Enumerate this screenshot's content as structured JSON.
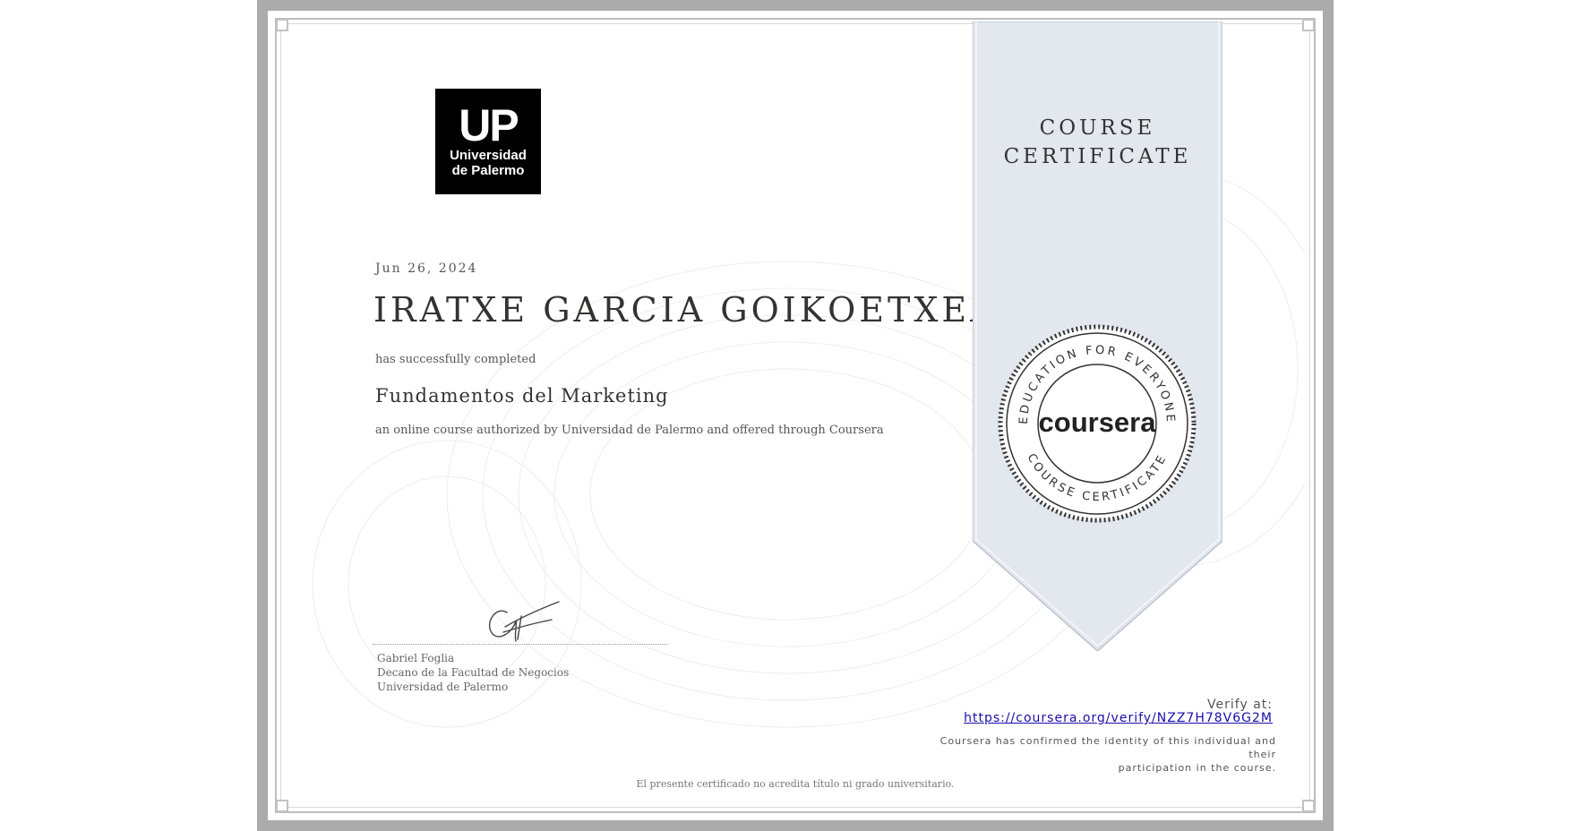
{
  "institution": {
    "logo_big": "UP",
    "logo_line1": "Universidad",
    "logo_line2": "de Palermo"
  },
  "certificate": {
    "date": "Jun 26, 2024",
    "recipient": "IRATXE GARCIA GOIKOETXEA",
    "completed_text": "has successfully completed",
    "course_name": "Fundamentos del Marketing",
    "authorization": "an online course authorized by Universidad de Palermo and offered through Coursera"
  },
  "signatory": {
    "name": "Gabriel Foglia",
    "title": "Decano de la Facultad de Negocios",
    "organization": "Universidad de Palermo"
  },
  "ribbon": {
    "line1": "COURSE",
    "line2": "CERTIFICATE"
  },
  "seal": {
    "brand": "coursera",
    "top_arc": "EDUCATION FOR EVERYONE",
    "bottom_arc": "COURSE CERTIFICATE"
  },
  "verify": {
    "label": "Verify at:",
    "url": "https://coursera.org/verify/NZZ7H78V6G2M",
    "confirm_line1": "Coursera has confirmed the identity of this individual and their",
    "confirm_line2": "participation in the course."
  },
  "footer_note": "El presente certificado no acredita título ni grado universitario.",
  "colors": {
    "frame": "#ababab",
    "ribbon": "#e3e7ee",
    "link": "#1a0dab",
    "seal_ink": "#333333"
  }
}
